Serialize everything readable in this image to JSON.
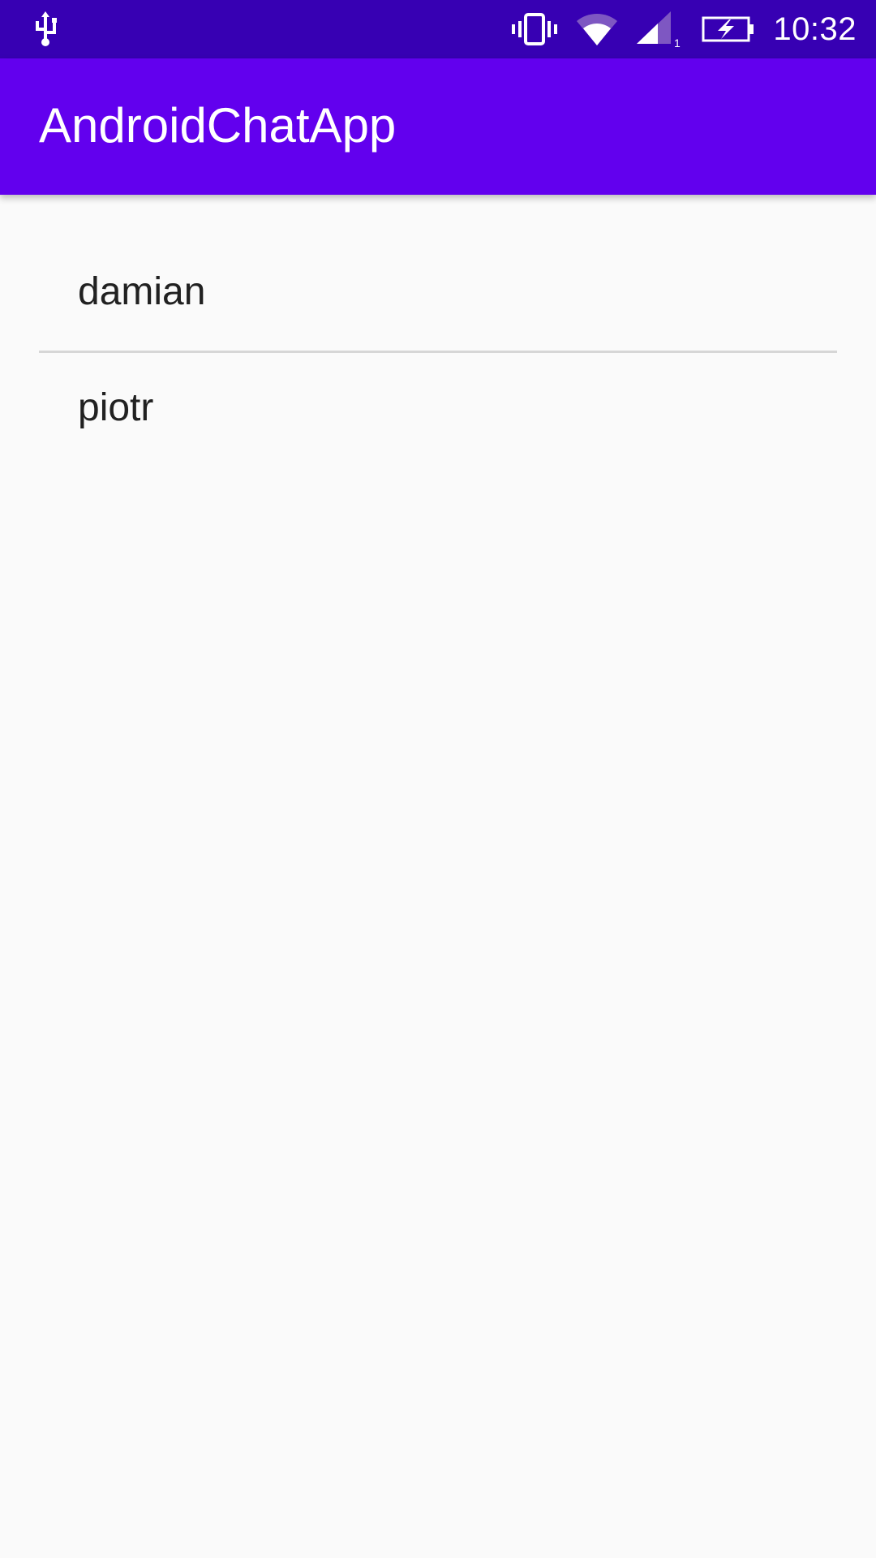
{
  "status_bar": {
    "time": "10:32",
    "icons": [
      "usb-icon",
      "vibrate-icon",
      "wifi-icon",
      "signal-icon",
      "battery-charging-icon"
    ],
    "sim_slot": "1",
    "background": "#3700b3"
  },
  "app_bar": {
    "title": "AndroidChatApp",
    "background": "#6200ee"
  },
  "contacts": {
    "items": [
      {
        "label": "damian"
      },
      {
        "label": "piotr"
      }
    ]
  }
}
